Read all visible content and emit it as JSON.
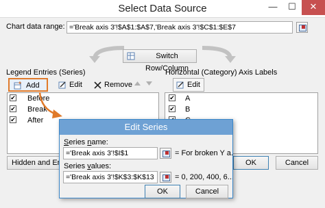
{
  "window": {
    "title": "Select Data Source",
    "minimize_glyph": "—",
    "maximize_glyph": "☐",
    "close_glyph": "✕"
  },
  "chart_range": {
    "label": "Chart data range:",
    "value": "='Break axis 3'!$A$1:$A$7,'Break axis 3'!$C$1:$E$7"
  },
  "switch_button": {
    "label": "Switch Row/Column"
  },
  "legend": {
    "heading": "Legend Entries (Series)",
    "add_label": "Add",
    "edit_label": "Edit",
    "remove_label": "Remove",
    "items": [
      {
        "label": "Before",
        "checked": true
      },
      {
        "label": "Break",
        "checked": true
      },
      {
        "label": "After",
        "checked": true
      }
    ]
  },
  "axis": {
    "heading": "Horizontal (Category) Axis Labels",
    "edit_label": "Edit",
    "items": [
      {
        "label": "A",
        "checked": true
      },
      {
        "label": "B",
        "checked": true
      },
      {
        "label": "C",
        "checked": true
      }
    ]
  },
  "footer": {
    "hidden_label": "Hidden and Emp",
    "ok_label": "OK",
    "cancel_label": "Cancel"
  },
  "edit_series": {
    "title": "Edit Series",
    "name_label": "Series name:",
    "name_value": "='Break axis 3'!$I$1",
    "name_result": "= For broken Y a...",
    "values_label": "Series values:",
    "values_value": "='Break axis 3'!$K$3:$K$13",
    "values_result": "= 0, 200, 400, 6...",
    "ok_label": "OK",
    "cancel_label": "Cancel"
  },
  "colors": {
    "accent": "#3a86c8",
    "highlight": "#e07a2a",
    "close": "#c75050"
  }
}
